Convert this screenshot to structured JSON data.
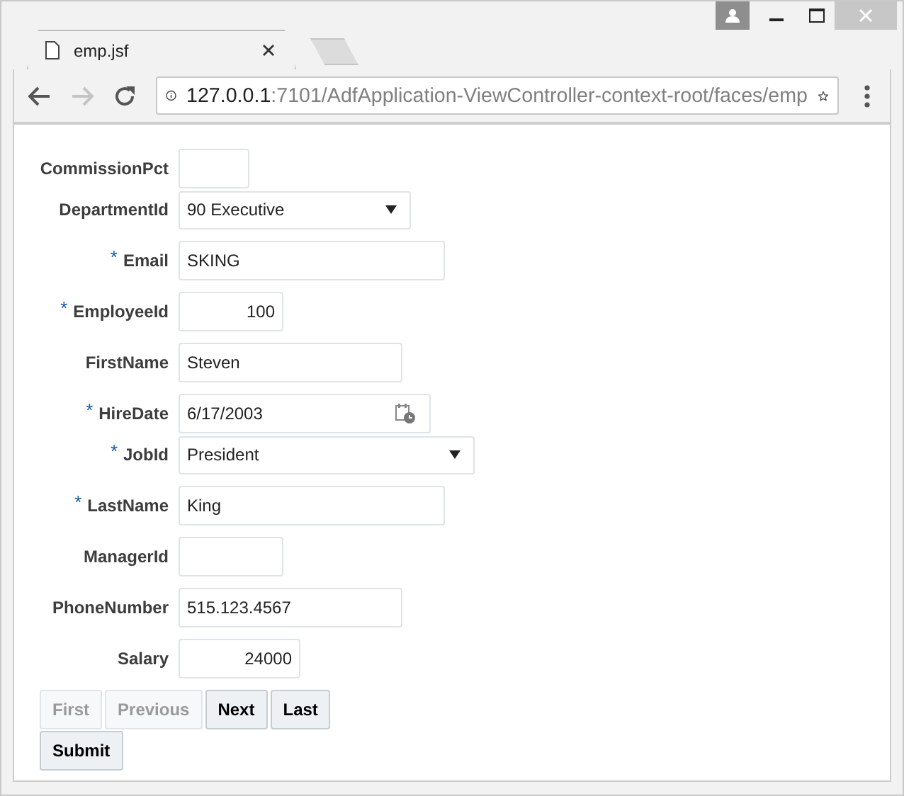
{
  "browser": {
    "tab_title": "emp.jsf",
    "address": {
      "host": "127.0.0.1",
      "path": ":7101/AdfApplication-ViewController-context-root/faces/emp"
    }
  },
  "required_mark": "*",
  "fields": [
    {
      "label": "CommissionPct",
      "required": false,
      "kind": "number"
    },
    {
      "label": "DepartmentId",
      "required": false,
      "kind": "select",
      "value": "90 Executive"
    },
    {
      "label": "Email",
      "required": true,
      "kind": "text",
      "value": "SKING"
    },
    {
      "label": "EmployeeId",
      "required": true,
      "kind": "number",
      "value": "100"
    },
    {
      "label": "FirstName",
      "required": false,
      "kind": "text",
      "value": "Steven"
    },
    {
      "label": "HireDate",
      "required": true,
      "kind": "date",
      "value": "6/17/2003"
    },
    {
      "label": "JobId",
      "required": true,
      "kind": "select",
      "value": "President"
    },
    {
      "label": "LastName",
      "required": true,
      "kind": "text",
      "value": "King"
    },
    {
      "label": "ManagerId",
      "required": false,
      "kind": "number"
    },
    {
      "label": "PhoneNumber",
      "required": false,
      "kind": "text",
      "value": "515.123.4567"
    },
    {
      "label": "Salary",
      "required": false,
      "kind": "number",
      "value": "24000"
    }
  ],
  "nav_buttons": [
    {
      "label": "First",
      "disabled": true
    },
    {
      "label": "Previous",
      "disabled": true
    },
    {
      "label": "Next",
      "disabled": false
    },
    {
      "label": "Last",
      "disabled": false
    }
  ],
  "submit_button": {
    "label": "Submit",
    "disabled": false
  }
}
